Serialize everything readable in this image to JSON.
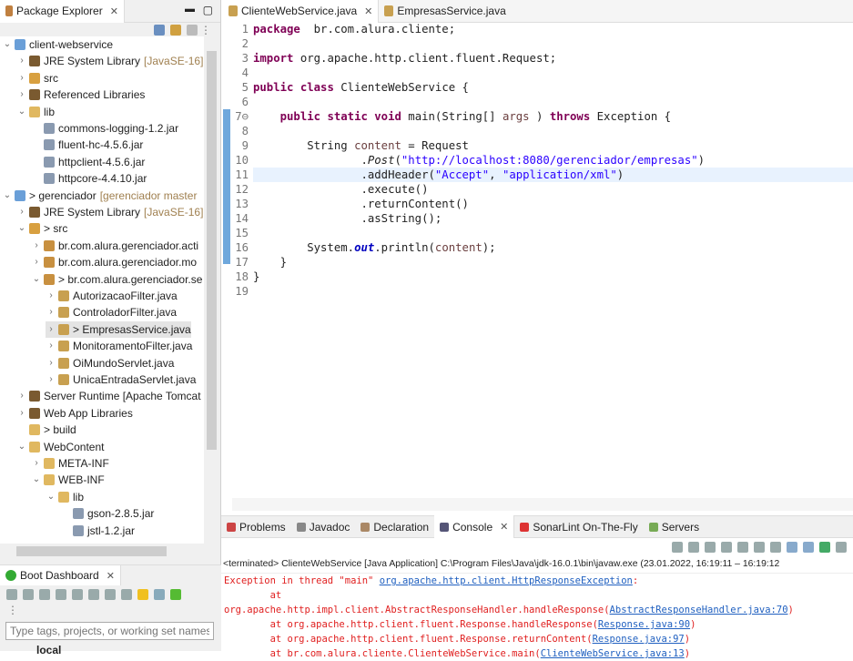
{
  "package_explorer": {
    "title": "Package Explorer",
    "items": [
      {
        "level": 0,
        "expand": "open",
        "icon": "project",
        "label": "client-webservice"
      },
      {
        "level": 1,
        "expand": "closed",
        "icon": "library",
        "label": "JRE System Library",
        "deco": "[JavaSE-16]"
      },
      {
        "level": 1,
        "expand": "closed",
        "icon": "source-folder",
        "label": "src"
      },
      {
        "level": 1,
        "expand": "closed",
        "icon": "library",
        "label": "Referenced Libraries"
      },
      {
        "level": 1,
        "expand": "open",
        "icon": "folder",
        "label": "lib"
      },
      {
        "level": 2,
        "expand": "none",
        "icon": "jar",
        "label": "commons-logging-1.2.jar"
      },
      {
        "level": 2,
        "expand": "none",
        "icon": "jar",
        "label": "fluent-hc-4.5.6.jar"
      },
      {
        "level": 2,
        "expand": "none",
        "icon": "jar",
        "label": "httpclient-4.5.6.jar"
      },
      {
        "level": 2,
        "expand": "none",
        "icon": "jar",
        "label": "httpcore-4.4.10.jar"
      },
      {
        "level": 0,
        "expand": "open",
        "icon": "project",
        "label": "> gerenciador",
        "deco": "[gerenciador master"
      },
      {
        "level": 1,
        "expand": "closed",
        "icon": "library",
        "label": "JRE System Library",
        "deco": "[JavaSE-16]"
      },
      {
        "level": 1,
        "expand": "open",
        "icon": "source-folder",
        "label": "> src"
      },
      {
        "level": 2,
        "expand": "closed",
        "icon": "package",
        "label": "br.com.alura.gerenciador.acti"
      },
      {
        "level": 2,
        "expand": "closed",
        "icon": "package",
        "label": "br.com.alura.gerenciador.mo"
      },
      {
        "level": 2,
        "expand": "open",
        "icon": "package",
        "label": "> br.com.alura.gerenciador.se"
      },
      {
        "level": 3,
        "expand": "closed",
        "icon": "java-file",
        "label": "AutorizacaoFilter.java"
      },
      {
        "level": 3,
        "expand": "closed",
        "icon": "java-file",
        "label": "ControladorFilter.java"
      },
      {
        "level": 3,
        "expand": "closed",
        "icon": "java-file",
        "label": "> EmpresasService.java",
        "selected": true
      },
      {
        "level": 3,
        "expand": "closed",
        "icon": "java-file",
        "label": "MonitoramentoFilter.java"
      },
      {
        "level": 3,
        "expand": "closed",
        "icon": "java-file",
        "label": "OiMundoServlet.java"
      },
      {
        "level": 3,
        "expand": "closed",
        "icon": "java-file",
        "label": "UnicaEntradaServlet.java"
      },
      {
        "level": 1,
        "expand": "closed",
        "icon": "library",
        "label": "Server Runtime [Apache Tomcat"
      },
      {
        "level": 1,
        "expand": "closed",
        "icon": "library",
        "label": "Web App Libraries"
      },
      {
        "level": 1,
        "expand": "none",
        "icon": "folder",
        "label": "> build"
      },
      {
        "level": 1,
        "expand": "open",
        "icon": "folder",
        "label": "WebContent"
      },
      {
        "level": 2,
        "expand": "closed",
        "icon": "folder",
        "label": "META-INF"
      },
      {
        "level": 2,
        "expand": "open",
        "icon": "folder",
        "label": "WEB-INF"
      },
      {
        "level": 3,
        "expand": "open",
        "icon": "folder",
        "label": "lib"
      },
      {
        "level": 4,
        "expand": "none",
        "icon": "jar",
        "label": "gson-2.8.5.jar"
      },
      {
        "level": 4,
        "expand": "none",
        "icon": "jar",
        "label": "jstl-1.2.jar"
      }
    ]
  },
  "boot_dashboard": {
    "title": "Boot Dashboard",
    "filter_placeholder": "Type tags, projects, or working set names t",
    "first_item": "local"
  },
  "editor": {
    "tabs": [
      {
        "label": "ClienteWebService.java",
        "active": true
      },
      {
        "label": "EmpresasService.java",
        "active": false
      }
    ],
    "highlighted_line": 11,
    "lines": [
      [
        [
          "kw",
          "package"
        ],
        [
          "",
          "  br.com.alura.cliente;"
        ]
      ],
      [],
      [
        [
          "kw",
          "import"
        ],
        [
          "",
          " org.apache.http.client.fluent.Request;"
        ]
      ],
      [],
      [
        [
          "kw",
          "public"
        ],
        [
          "",
          " "
        ],
        [
          "kw",
          "class"
        ],
        [
          "",
          " ClienteWebService {"
        ]
      ],
      [],
      [
        [
          "",
          "    "
        ],
        [
          "kw",
          "public"
        ],
        [
          "",
          " "
        ],
        [
          "kw",
          "static"
        ],
        [
          "",
          " "
        ],
        [
          "kw",
          "void"
        ],
        [
          "",
          " main(String[] "
        ],
        [
          "var",
          "args"
        ],
        [
          "",
          " ) "
        ],
        [
          "kw",
          "throws"
        ],
        [
          "",
          " Exception {"
        ]
      ],
      [],
      [
        [
          "",
          "        String "
        ],
        [
          "var",
          "content"
        ],
        [
          "",
          " = Request"
        ]
      ],
      [
        [
          "",
          "                ."
        ],
        [
          "it",
          "Post"
        ],
        [
          "",
          "("
        ],
        [
          "str",
          "\"http://localhost:8080/gerenciador/empresas\""
        ],
        [
          "",
          ")"
        ]
      ],
      [
        [
          "",
          "                .addHeader("
        ],
        [
          "str",
          "\"Accept\""
        ],
        [
          "",
          ", "
        ],
        [
          "str",
          "\"application/xml\""
        ],
        [
          "",
          ")"
        ]
      ],
      [
        [
          "",
          "                .execute()"
        ]
      ],
      [
        [
          "",
          "                .returnContent()"
        ]
      ],
      [
        [
          "",
          "                .asString();"
        ]
      ],
      [],
      [
        [
          "",
          "        System."
        ],
        [
          "fld",
          "out"
        ],
        [
          "",
          ".println("
        ],
        [
          "var",
          "content"
        ],
        [
          "",
          ");"
        ]
      ],
      [
        [
          "",
          "    }"
        ]
      ],
      [
        [
          "",
          "}"
        ]
      ],
      []
    ]
  },
  "bottom_panel": {
    "tabs": [
      "Problems",
      "Javadoc",
      "Declaration",
      "Console",
      "SonarLint On-The-Fly",
      "Servers"
    ],
    "active_tab": "Console",
    "console_header": "<terminated> ClienteWebService [Java Application] C:\\Program Files\\Java\\jdk-16.0.1\\bin\\javaw.exe  (23.01.2022, 16:19:11 – 16:19:12",
    "lines": [
      [
        [
          "",
          "Exception in thread \"main\" "
        ],
        [
          "link",
          "org.apache.http.client.HttpResponseException"
        ],
        [
          "",
          ":"
        ]
      ],
      [
        [
          "",
          "        at org.apache.http.impl.client.AbstractResponseHandler.handleResponse("
        ],
        [
          "link",
          "AbstractResponseHandler.java:70"
        ],
        [
          "",
          ")"
        ]
      ],
      [
        [
          "",
          "        at org.apache.http.client.fluent.Response.handleResponse("
        ],
        [
          "link",
          "Response.java:90"
        ],
        [
          "",
          ")"
        ]
      ],
      [
        [
          "",
          "        at org.apache.http.client.fluent.Response.returnContent("
        ],
        [
          "link",
          "Response.java:97"
        ],
        [
          "",
          ")"
        ]
      ],
      [
        [
          "",
          "        at br.com.alura.cliente.ClienteWebService.main("
        ],
        [
          "link",
          "ClienteWebService.java:13"
        ],
        [
          "",
          ")"
        ]
      ]
    ]
  },
  "colors": {
    "keyword": "#7f0055",
    "string": "#2a00ff",
    "error": "#e02020",
    "link": "#2060c0",
    "highlight": "#e8f2fe"
  }
}
